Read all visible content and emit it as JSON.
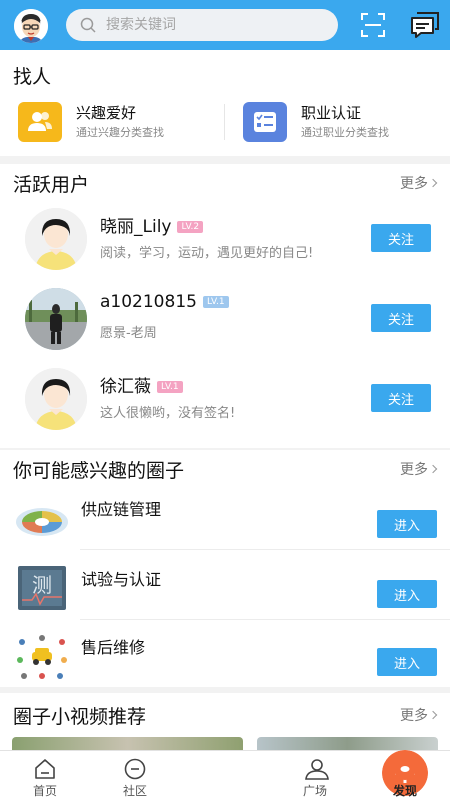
{
  "search": {
    "placeholder": "搜索关键词"
  },
  "find": {
    "title": "找人",
    "cards": [
      {
        "label": "兴趣爱好",
        "sub": "通过兴趣分类查找",
        "icon": "people-icon",
        "color": "#f6b81b"
      },
      {
        "label": "职业认证",
        "sub": "通过职业分类查找",
        "icon": "id-card-icon",
        "color": "#5a83de"
      }
    ]
  },
  "users": {
    "title": "活跃用户",
    "more": "更多",
    "items": [
      {
        "name": "晓丽_Lily",
        "level": "LV.2",
        "desc": "阅读，学习，运动，遇见更好的自己!",
        "action": "关注"
      },
      {
        "name": "a10210815",
        "level": "LV.1",
        "desc": "愿景-老周",
        "action": "关注"
      },
      {
        "name": "徐汇薇",
        "level": "LV.1",
        "desc": "这人很懒哟，没有签名!",
        "action": "关注"
      }
    ]
  },
  "circles": {
    "title": "你可能感兴趣的圈子",
    "more": "更多",
    "items": [
      {
        "name": "供应链管理",
        "action": "进入"
      },
      {
        "name": "试验与认证",
        "action": "进入"
      },
      {
        "name": "售后维修",
        "action": "进入"
      }
    ]
  },
  "videos": {
    "title": "圈子小视频推荐",
    "more": "更多"
  },
  "tabs": [
    {
      "label": "首页",
      "icon": "home-icon"
    },
    {
      "label": "社区",
      "icon": "community-icon"
    },
    {
      "label": "",
      "icon": "plus-icon"
    },
    {
      "label": "广场",
      "icon": "square-icon"
    },
    {
      "label": "发现",
      "icon": "discover-icon",
      "active": true
    }
  ],
  "colors": {
    "accent": "#3aa8ee",
    "plus": "#f46a3a",
    "discover": "#f46a3a"
  }
}
